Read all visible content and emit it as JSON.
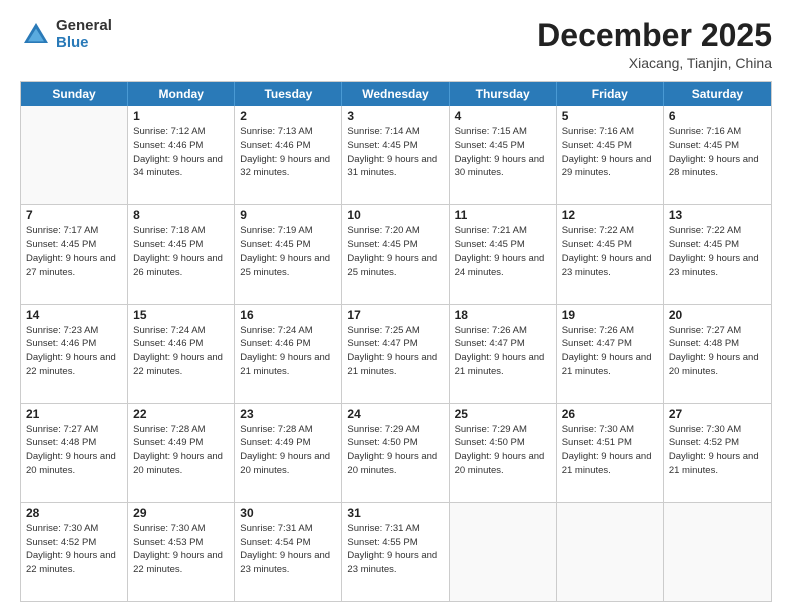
{
  "header": {
    "logo_general": "General",
    "logo_blue": "Blue",
    "month_title": "December 2025",
    "subtitle": "Xiacang, Tianjin, China"
  },
  "calendar": {
    "days_of_week": [
      "Sunday",
      "Monday",
      "Tuesday",
      "Wednesday",
      "Thursday",
      "Friday",
      "Saturday"
    ],
    "weeks": [
      [
        {
          "day": "",
          "empty": true
        },
        {
          "day": "1",
          "sunrise": "7:12 AM",
          "sunset": "4:46 PM",
          "daylight": "9 hours and 34 minutes."
        },
        {
          "day": "2",
          "sunrise": "7:13 AM",
          "sunset": "4:46 PM",
          "daylight": "9 hours and 32 minutes."
        },
        {
          "day": "3",
          "sunrise": "7:14 AM",
          "sunset": "4:45 PM",
          "daylight": "9 hours and 31 minutes."
        },
        {
          "day": "4",
          "sunrise": "7:15 AM",
          "sunset": "4:45 PM",
          "daylight": "9 hours and 30 minutes."
        },
        {
          "day": "5",
          "sunrise": "7:16 AM",
          "sunset": "4:45 PM",
          "daylight": "9 hours and 29 minutes."
        },
        {
          "day": "6",
          "sunrise": "7:16 AM",
          "sunset": "4:45 PM",
          "daylight": "9 hours and 28 minutes."
        }
      ],
      [
        {
          "day": "7",
          "sunrise": "7:17 AM",
          "sunset": "4:45 PM",
          "daylight": "9 hours and 27 minutes."
        },
        {
          "day": "8",
          "sunrise": "7:18 AM",
          "sunset": "4:45 PM",
          "daylight": "9 hours and 26 minutes."
        },
        {
          "day": "9",
          "sunrise": "7:19 AM",
          "sunset": "4:45 PM",
          "daylight": "9 hours and 25 minutes."
        },
        {
          "day": "10",
          "sunrise": "7:20 AM",
          "sunset": "4:45 PM",
          "daylight": "9 hours and 25 minutes."
        },
        {
          "day": "11",
          "sunrise": "7:21 AM",
          "sunset": "4:45 PM",
          "daylight": "9 hours and 24 minutes."
        },
        {
          "day": "12",
          "sunrise": "7:22 AM",
          "sunset": "4:45 PM",
          "daylight": "9 hours and 23 minutes."
        },
        {
          "day": "13",
          "sunrise": "7:22 AM",
          "sunset": "4:45 PM",
          "daylight": "9 hours and 23 minutes."
        }
      ],
      [
        {
          "day": "14",
          "sunrise": "7:23 AM",
          "sunset": "4:46 PM",
          "daylight": "9 hours and 22 minutes."
        },
        {
          "day": "15",
          "sunrise": "7:24 AM",
          "sunset": "4:46 PM",
          "daylight": "9 hours and 22 minutes."
        },
        {
          "day": "16",
          "sunrise": "7:24 AM",
          "sunset": "4:46 PM",
          "daylight": "9 hours and 21 minutes."
        },
        {
          "day": "17",
          "sunrise": "7:25 AM",
          "sunset": "4:47 PM",
          "daylight": "9 hours and 21 minutes."
        },
        {
          "day": "18",
          "sunrise": "7:26 AM",
          "sunset": "4:47 PM",
          "daylight": "9 hours and 21 minutes."
        },
        {
          "day": "19",
          "sunrise": "7:26 AM",
          "sunset": "4:47 PM",
          "daylight": "9 hours and 21 minutes."
        },
        {
          "day": "20",
          "sunrise": "7:27 AM",
          "sunset": "4:48 PM",
          "daylight": "9 hours and 20 minutes."
        }
      ],
      [
        {
          "day": "21",
          "sunrise": "7:27 AM",
          "sunset": "4:48 PM",
          "daylight": "9 hours and 20 minutes."
        },
        {
          "day": "22",
          "sunrise": "7:28 AM",
          "sunset": "4:49 PM",
          "daylight": "9 hours and 20 minutes."
        },
        {
          "day": "23",
          "sunrise": "7:28 AM",
          "sunset": "4:49 PM",
          "daylight": "9 hours and 20 minutes."
        },
        {
          "day": "24",
          "sunrise": "7:29 AM",
          "sunset": "4:50 PM",
          "daylight": "9 hours and 20 minutes."
        },
        {
          "day": "25",
          "sunrise": "7:29 AM",
          "sunset": "4:50 PM",
          "daylight": "9 hours and 20 minutes."
        },
        {
          "day": "26",
          "sunrise": "7:30 AM",
          "sunset": "4:51 PM",
          "daylight": "9 hours and 21 minutes."
        },
        {
          "day": "27",
          "sunrise": "7:30 AM",
          "sunset": "4:52 PM",
          "daylight": "9 hours and 21 minutes."
        }
      ],
      [
        {
          "day": "28",
          "sunrise": "7:30 AM",
          "sunset": "4:52 PM",
          "daylight": "9 hours and 22 minutes."
        },
        {
          "day": "29",
          "sunrise": "7:30 AM",
          "sunset": "4:53 PM",
          "daylight": "9 hours and 22 minutes."
        },
        {
          "day": "30",
          "sunrise": "7:31 AM",
          "sunset": "4:54 PM",
          "daylight": "9 hours and 23 minutes."
        },
        {
          "day": "31",
          "sunrise": "7:31 AM",
          "sunset": "4:55 PM",
          "daylight": "9 hours and 23 minutes."
        },
        {
          "day": "",
          "empty": true
        },
        {
          "day": "",
          "empty": true
        },
        {
          "day": "",
          "empty": true
        }
      ]
    ]
  }
}
